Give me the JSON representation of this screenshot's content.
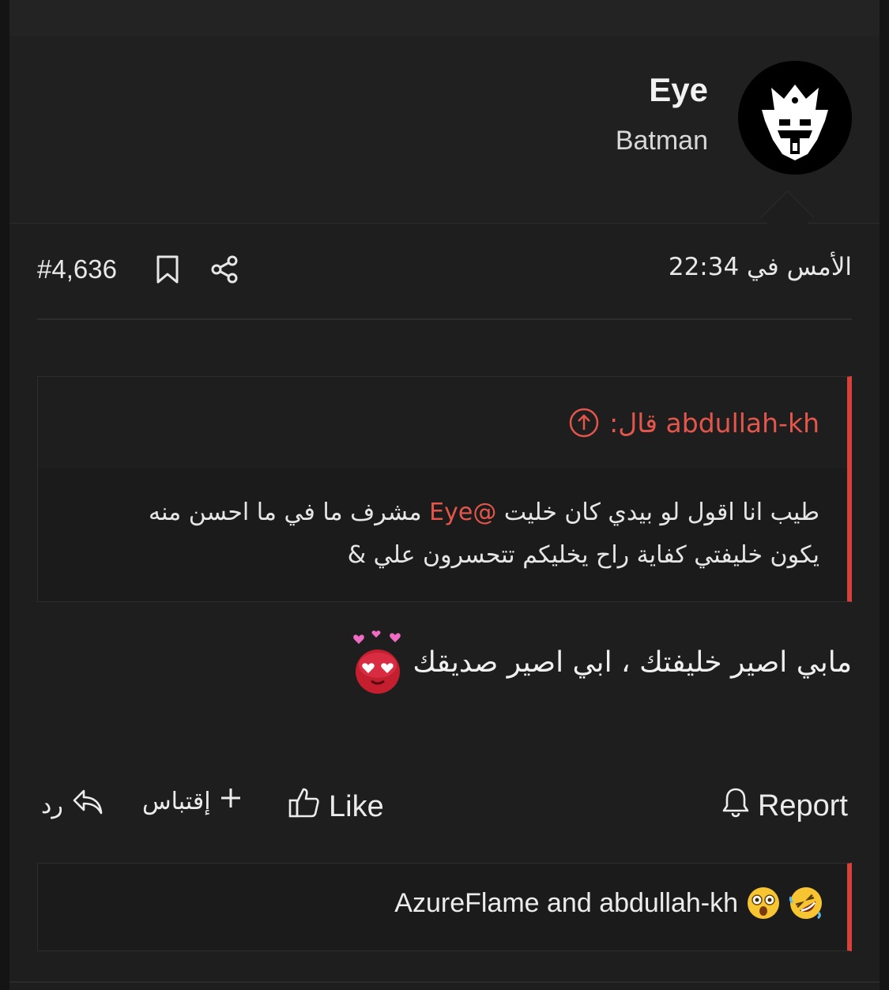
{
  "author": {
    "name": "Eye",
    "title": "Batman",
    "avatar_icon": "crowned-mask-logo"
  },
  "meta": {
    "post_number": "#4,636",
    "date": "الأمس في 22:34",
    "bookmark_icon": "bookmark-icon",
    "share_icon": "share-icon"
  },
  "quote": {
    "author_label": "abdullah-kh قال:",
    "line1_before": "طيب انا اقول لو بيدي كان خليت ",
    "mention": "@Eye",
    "line1_after": " مشرف ما في ما احسن منه",
    "line2": "يكون خليفتي كفاية راح يخليكم تتحسرون علي &"
  },
  "message": {
    "text": "مابي اصير خليفتك ، ابي اصير صديقك",
    "emoji": "heart-eyes-face"
  },
  "actions": {
    "reply": "رد",
    "quote": "إقتباس",
    "like": "Like",
    "report": "Report"
  },
  "reactions": {
    "text": "AzureFlame and abdullah-kh",
    "emojis": [
      "rofl-emoji",
      "astonished-emoji"
    ]
  },
  "colors": {
    "accent": "#e4564c",
    "quote_border": "#d5423c",
    "background": "#1e1e1e"
  }
}
